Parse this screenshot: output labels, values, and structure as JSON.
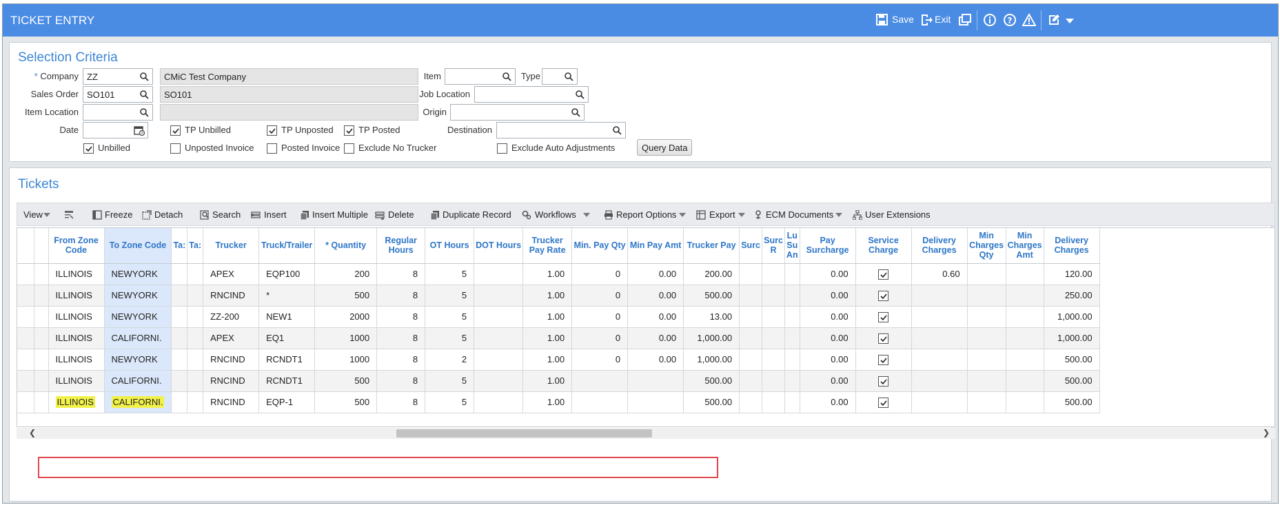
{
  "window": {
    "title": "TICKET ENTRY"
  },
  "header_actions": {
    "save": "Save",
    "exit": "Exit"
  },
  "selection": {
    "title": "Selection Criteria",
    "company": {
      "label": "Company",
      "required": "*",
      "value": "ZZ",
      "name": "CMiC Test Company"
    },
    "sales_order": {
      "label": "Sales Order",
      "value": "SO101",
      "name": "SO101"
    },
    "item_location": {
      "label": "Item Location",
      "value": "",
      "name": ""
    },
    "date": {
      "label": "Date",
      "value": ""
    },
    "item": {
      "label": "Item",
      "value": ""
    },
    "type": {
      "label": "Type",
      "value": ""
    },
    "job_location": {
      "label": "Job Location",
      "value": ""
    },
    "origin": {
      "label": "Origin",
      "value": ""
    },
    "destination": {
      "label": "Destination",
      "value": ""
    },
    "checks": {
      "tp_unbilled": {
        "label": "TP Unbilled",
        "checked": true
      },
      "tp_unposted": {
        "label": "TP Unposted",
        "checked": true
      },
      "tp_posted": {
        "label": "TP Posted",
        "checked": true
      },
      "unbilled": {
        "label": "Unbilled",
        "checked": true
      },
      "unposted_invoice": {
        "label": "Unposted Invoice",
        "checked": false
      },
      "posted_invoice": {
        "label": "Posted Invoice",
        "checked": false
      },
      "exclude_no_trucker": {
        "label": "Exclude No Trucker",
        "checked": false
      },
      "exclude_auto_adjustments": {
        "label": "Exclude Auto Adjustments",
        "checked": false
      }
    },
    "query_button": "Query Data"
  },
  "tickets": {
    "title": "Tickets",
    "toolbar": {
      "view": "View",
      "freeze": "Freeze",
      "detach": "Detach",
      "search": "Search",
      "insert": "Insert",
      "insert_multiple": "Insert Multiple",
      "delete": "Delete",
      "duplicate_record": "Duplicate Record",
      "workflows": "Workflows",
      "report_options": "Report Options",
      "export": "Export",
      "ecm_documents": "ECM Documents",
      "user_extensions": "User Extensions"
    },
    "columns": {
      "from_zone": "From Zone Code",
      "to_zone": "To Zone Code",
      "tax1": "Ta:",
      "tax2": "Ta:",
      "trucker": "Trucker",
      "truck_trailer": "Truck/Trailer",
      "quantity": "* Quantity",
      "regular_hours": "Regular Hours",
      "ot_hours": "OT Hours",
      "dot_hours": "DOT Hours",
      "trucker_pay_rate": "Trucker Pay Rate",
      "min_pay_qty": "Min. Pay Qty",
      "min_pay_amt": "Min Pay Amt",
      "trucker_pay": "Trucker Pay",
      "surc1": "Surc",
      "surc2": "Surc R",
      "lu": "Lu Su An",
      "pay_surcharge": "Pay Surcharge",
      "service_charge": "Service Charge",
      "delivery_charges1": "Delivery Charges",
      "min_charges_qty": "Min Charges Qty",
      "min_charges_amt": "Min Charges Amt",
      "delivery_charges2": "Delivery Charges"
    },
    "rows": [
      {
        "from": "ILLINOIS",
        "to": "NEWYORK",
        "trucker": "APEX",
        "truck": "EQP100",
        "qty": "200",
        "reg": "8",
        "ot": "5",
        "dot": "",
        "rate": "1.00",
        "minq": "0",
        "mina": "0.00",
        "pay": "200.00",
        "surch": "0.00",
        "svc": true,
        "del1": "0.60",
        "del2": "120.00"
      },
      {
        "from": "ILLINOIS",
        "to": "NEWYORK",
        "trucker": "RNCIND",
        "truck": "*",
        "qty": "500",
        "reg": "8",
        "ot": "5",
        "dot": "",
        "rate": "1.00",
        "minq": "0",
        "mina": "0.00",
        "pay": "500.00",
        "surch": "0.00",
        "svc": true,
        "del1": "",
        "del2": "250.00"
      },
      {
        "from": "ILLINOIS",
        "to": "NEWYORK",
        "trucker": "ZZ-200",
        "truck": "NEW1",
        "qty": "2000",
        "reg": "8",
        "ot": "5",
        "dot": "",
        "rate": "1.00",
        "minq": "0",
        "mina": "0.00",
        "pay": "13.00",
        "surch": "0.00",
        "svc": true,
        "del1": "",
        "del2": "1,000.00"
      },
      {
        "from": "ILLINOIS",
        "to": "CALIFORNI.",
        "trucker": "APEX",
        "truck": "EQ1",
        "qty": "1000",
        "reg": "8",
        "ot": "5",
        "dot": "",
        "rate": "1.00",
        "minq": "0",
        "mina": "0.00",
        "pay": "1,000.00",
        "surch": "0.00",
        "svc": true,
        "del1": "",
        "del2": "1,000.00"
      },
      {
        "from": "ILLINOIS",
        "to": "NEWYORK",
        "trucker": "RNCIND",
        "truck": "RCNDT1",
        "qty": "1000",
        "reg": "8",
        "ot": "2",
        "dot": "",
        "rate": "1.00",
        "minq": "0",
        "mina": "0.00",
        "pay": "1,000.00",
        "surch": "0.00",
        "svc": true,
        "del1": "",
        "del2": "500.00"
      },
      {
        "from": "ILLINOIS",
        "to": "CALIFORNI.",
        "trucker": "RNCIND",
        "truck": "RCNDT1",
        "qty": "500",
        "reg": "8",
        "ot": "5",
        "dot": "",
        "rate": "1.00",
        "minq": "",
        "mina": "",
        "pay": "500.00",
        "surch": "0.00",
        "svc": true,
        "del1": "",
        "del2": "500.00"
      },
      {
        "from": "ILLINOIS",
        "to": "CALIFORNI.",
        "trucker": "RNCIND",
        "truck": "EQP-1",
        "qty": "500",
        "reg": "8",
        "ot": "5",
        "dot": "",
        "rate": "1.00",
        "minq": "",
        "mina": "",
        "pay": "500.00",
        "surch": "0.00",
        "svc": true,
        "del1": "",
        "del2": "500.00"
      }
    ]
  },
  "colors": {
    "header_blue": "#4a8be4",
    "link_blue": "#3b85d6",
    "highlight": "#f2f24a",
    "callout_red": "#e0474c"
  }
}
